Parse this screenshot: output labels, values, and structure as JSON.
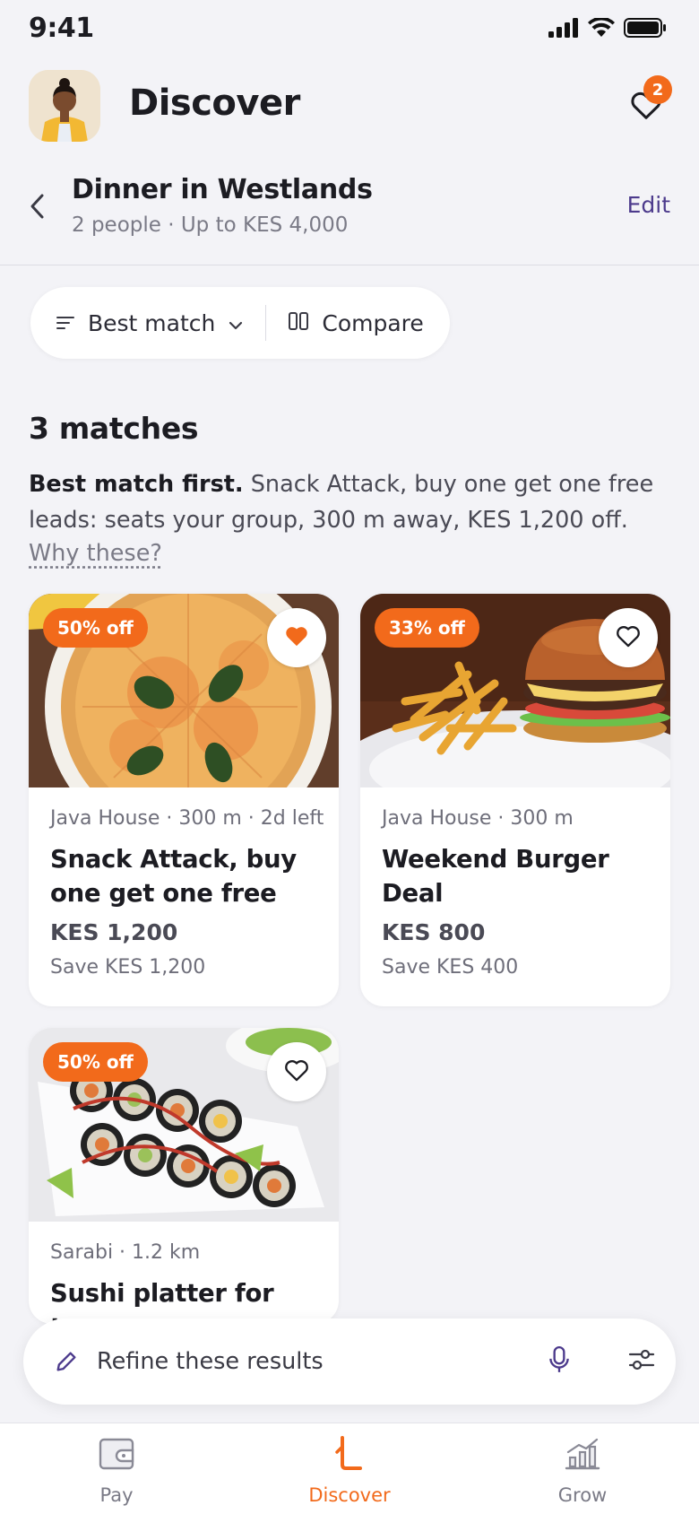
{
  "status_bar": {
    "time": "9:41"
  },
  "header": {
    "title": "Discover",
    "favorites_count": "2"
  },
  "context": {
    "title": "Dinner in Westlands",
    "subtitle": "2 people · Up to KES 4,000",
    "edit_label": "Edit"
  },
  "sort_bar": {
    "sort_label": "Best match",
    "compare_label": "Compare"
  },
  "results": {
    "count_title": "3 matches",
    "summary_lead": "Best match first.",
    "summary_text": " Snack Attack, buy one get one free leads: seats your group, 300 m away, KES 1,200 off.",
    "why_link": "Why these?"
  },
  "cards": [
    {
      "discount": "50% off",
      "meta": "Java House · 300 m · 2d left",
      "title": "Snack Attack, buy one get one free",
      "price": "KES 1,200",
      "savings": "Save KES 1,200",
      "favorited": true,
      "image": "pizza-image"
    },
    {
      "discount": "33% off",
      "meta": "Java House · 300 m",
      "title": "Weekend Burger Deal",
      "price": "KES 800",
      "savings": "Save KES 400",
      "favorited": false,
      "image": "burger-image"
    },
    {
      "discount": "50% off",
      "meta": "Sarabi · 1.2 km",
      "title": "Sushi platter for two",
      "favorited": false,
      "image": "sushi-image"
    }
  ],
  "refine": {
    "placeholder": "Refine these results"
  },
  "tabs": [
    {
      "label": "Pay",
      "icon": "wallet-icon",
      "active": false
    },
    {
      "label": "Discover",
      "icon": "discover-icon",
      "active": true
    },
    {
      "label": "Grow",
      "icon": "growth-chart-icon",
      "active": false
    }
  ],
  "colors": {
    "accent": "#f26a1b",
    "link": "#4c3a8c",
    "background": "#f3f3f7"
  }
}
